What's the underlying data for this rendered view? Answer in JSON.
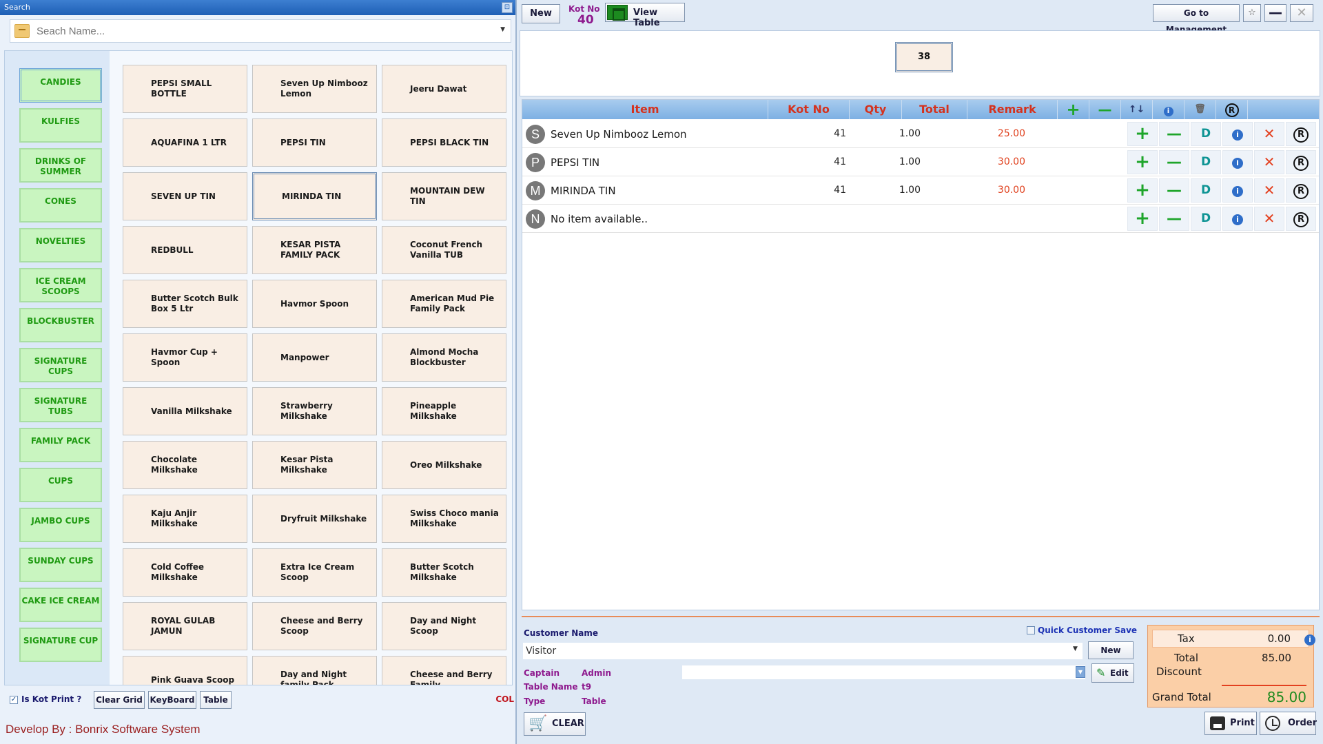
{
  "search": {
    "title": "Search",
    "placeholder": "Seach Name..."
  },
  "categories": [
    "CANDIES",
    "KULFIES",
    "DRINKS OF SUMMER",
    "CONES",
    "NOVELTIES",
    "ICE CREAM SCOOPS",
    "BLOCKBUSTER",
    "SIGNATURE CUPS",
    "SIGNATURE TUBS",
    "FAMILY PACK",
    "CUPS",
    "JAMBO CUPS",
    "SUNDAY CUPS",
    "CAKE ICE CREAM",
    "SIGNATURE CUP"
  ],
  "items": [
    "PEPSI SMALL BOTTLE",
    "Seven Up Nimbooz Lemon",
    "Jeeru Dawat",
    "AQUAFINA 1 LTR",
    "PEPSI TIN",
    "PEPSI BLACK TIN",
    "SEVEN UP TIN",
    "MIRINDA TIN",
    "MOUNTAIN DEW TIN",
    "REDBULL",
    "KESAR PISTA FAMILY PACK",
    "Coconut French Vanilla TUB",
    "Butter Scotch Bulk Box 5 Ltr",
    "Havmor Spoon",
    "American Mud Pie Family Pack",
    "Havmor Cup + Spoon",
    "Manpower",
    "Almond Mocha Blockbuster",
    "Vanilla Milkshake",
    "Strawberry Milkshake",
    "Pineapple Milkshake",
    "Chocolate Milkshake",
    "Kesar Pista Milkshake",
    "Oreo Milkshake",
    "Kaju Anjir Milkshake",
    "Dryfruit Milkshake",
    "Swiss Choco mania Milkshake",
    "Cold Coffee Milkshake",
    "Extra Ice Cream Scoop",
    "Butter Scotch Milkshake",
    "ROYAL GULAB JAMUN",
    "Cheese and Berry Scoop",
    "Day and Night Scoop",
    "Pink Guava Scoop",
    "Day and Night family Pack",
    "Cheese and Berry Family"
  ],
  "footer": {
    "kot_print_label": "Is Kot Print ?",
    "clear_grid": "Clear Grid",
    "keyboard": "KeyBoard",
    "table": "Table",
    "col_cut": "COL",
    "developer": "Develop By : Bonrix Software System"
  },
  "top": {
    "new_label": "New",
    "kot_no_label": "Kot No",
    "kot_no_value": "40",
    "view_table_label": "View Table",
    "go_management_label": "Go to Management",
    "table_tile": "38"
  },
  "grid": {
    "headers": {
      "item": "Item",
      "kot_no": "Kot No",
      "qty": "Qty",
      "total": "Total",
      "remark": "Remark"
    },
    "rows": [
      {
        "initial": "S",
        "name": "Seven Up Nimbooz Lemon",
        "kot": "41",
        "qty": "1.00",
        "total": "25.00"
      },
      {
        "initial": "P",
        "name": "PEPSI TIN",
        "kot": "41",
        "qty": "1.00",
        "total": "30.00"
      },
      {
        "initial": "M",
        "name": "MIRINDA TIN",
        "kot": "41",
        "qty": "1.00",
        "total": "30.00"
      },
      {
        "initial": "N",
        "name": "No item available..",
        "kot": "",
        "qty": "",
        "total": ""
      }
    ],
    "action_glyphs": {
      "plus": "+",
      "minus": "—",
      "discount": "D",
      "info": "i",
      "delete": "✕",
      "register": "R"
    }
  },
  "customer": {
    "label": "Customer Name",
    "quick_save_label": "Quick Customer Save",
    "name_value": "Visitor",
    "new_label": "New",
    "edit_label": "Edit",
    "captain_key": "Captain",
    "captain_value": "Admin",
    "table_key": "Table Name",
    "table_value": "t9",
    "type_key": "Type",
    "type_value": "Table",
    "clear_label": "CLEAR"
  },
  "totals": {
    "tax_label": "Tax",
    "tax_value": "0.00",
    "total_label": "Total",
    "total_value": "85.00",
    "discount_label": "Discount",
    "grand_total_label": "Grand Total",
    "grand_total_value": "85.00"
  },
  "actions": {
    "print_label": "Print",
    "order_label": "Order"
  },
  "colors": {
    "category_bg": "#c9f5c0",
    "category_text": "#1f9a12",
    "item_bg": "#f9eee4",
    "header_text": "#d4321e",
    "total_text": "#e0421f",
    "grand_total_text": "#1e8a1e"
  }
}
